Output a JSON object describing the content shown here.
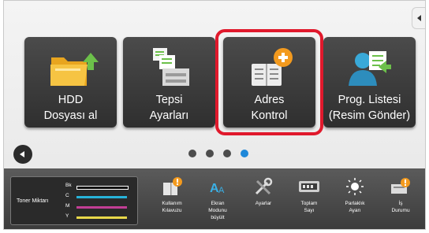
{
  "tiles": [
    {
      "line1": "HDD",
      "line2": "Dosyası al"
    },
    {
      "line1": "Tepsi",
      "line2": "Ayarları"
    },
    {
      "line1": "Adres",
      "line2": "Kontrol"
    },
    {
      "line1": "Prog. Listesi",
      "line2": "(Resim Gönder)"
    }
  ],
  "pagination": {
    "count": 4,
    "active_index": 3
  },
  "toner": {
    "label": "Toner Miktarı",
    "rows": [
      {
        "key": "Bk",
        "color": "#111111"
      },
      {
        "key": "C",
        "color": "#27b3d9"
      },
      {
        "key": "M",
        "color": "#c23e95"
      },
      {
        "key": "Y",
        "color": "#e8d84a"
      }
    ]
  },
  "quick": [
    {
      "icon": "user-guide-icon",
      "line1": "Kullanım",
      "line2": "Kılavuzu",
      "line3": ""
    },
    {
      "icon": "enlarge-display-icon",
      "line1": "Ekran",
      "line2": "Modunu",
      "line3": "büyült"
    },
    {
      "icon": "settings-tools-icon",
      "line1": "Ayarlar",
      "line2": "",
      "line3": ""
    },
    {
      "icon": "total-count-icon",
      "line1": "Toplam",
      "line2": "Sayı",
      "line3": ""
    },
    {
      "icon": "brightness-icon",
      "line1": "Parlaklık",
      "line2": "Ayarı",
      "line3": ""
    },
    {
      "icon": "job-status-icon",
      "line1": "İş",
      "line2": "Durumu",
      "line3": ""
    }
  ],
  "colors": {
    "highlight": "#e0192c",
    "active_dot": "#1e88d9",
    "badge": "#f39a1e"
  }
}
